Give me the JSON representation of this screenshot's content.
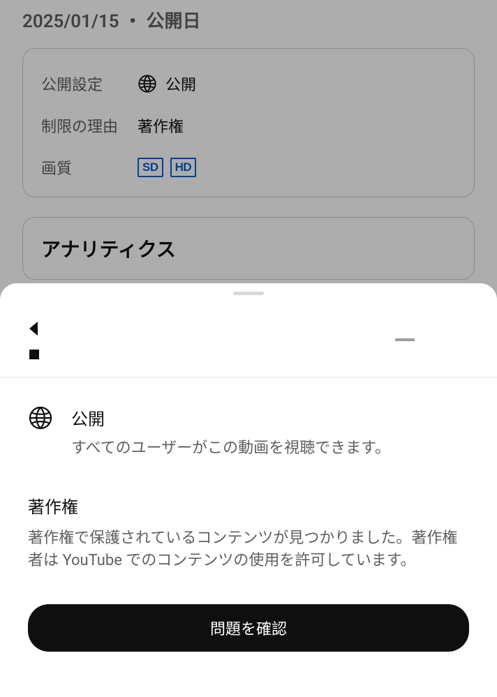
{
  "header": {
    "date_label": "2025/01/15 ・ 公開日"
  },
  "info": {
    "visibility_label": "公開設定",
    "visibility_value": "公開",
    "restriction_label": "制限の理由",
    "restriction_value": "著作権",
    "quality_label": "画質",
    "quality_badges": {
      "sd": "SD",
      "hd": "HD"
    }
  },
  "analytics": {
    "title": "アナリティクス"
  },
  "sheet": {
    "visibility": {
      "title": "公開",
      "description": "すべてのユーザーがこの動画を視聴できます。"
    },
    "copyright": {
      "title": "著作権",
      "description": "著作権で保護されているコンテンツが見つかりました。著作権者は YouTube でのコンテンツの使用を許可しています。"
    },
    "review_button": "問題を確認"
  }
}
